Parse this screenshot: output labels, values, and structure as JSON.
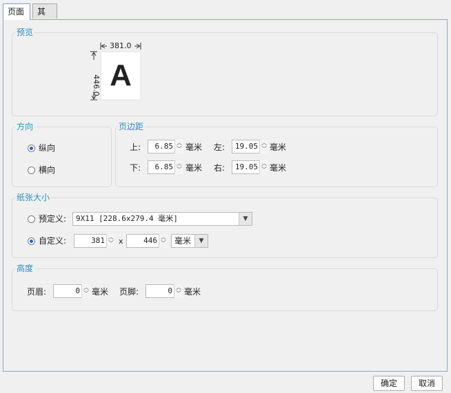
{
  "tabs": [
    {
      "label": "页面",
      "active": true
    },
    {
      "label": "其他",
      "active": false
    }
  ],
  "preview": {
    "title": "预览",
    "width_label": "381.0",
    "height_label": "446.0",
    "letter": "A"
  },
  "orientation": {
    "title": "方向",
    "portrait_label": "纵向",
    "landscape_label": "横向",
    "selected": "portrait"
  },
  "margins": {
    "title": "页边距",
    "top_label": "上:",
    "top_value": "6.85",
    "left_label": "左:",
    "left_value": "19.05",
    "bottom_label": "下:",
    "bottom_value": "6.85",
    "right_label": "右:",
    "right_value": "19.05",
    "unit": "毫米"
  },
  "paper": {
    "title": "纸张大小",
    "predefined_label": "预定义:",
    "predefined_value": "9X11 [228.6x279.4 毫米]",
    "custom_label": "自定义:",
    "custom_width": "381",
    "times": "x",
    "custom_height": "446",
    "unit_value": "毫米",
    "selected": "custom"
  },
  "height": {
    "title": "高度",
    "header_label": "页眉:",
    "header_value": "0",
    "footer_label": "页脚:",
    "footer_value": "0",
    "unit": "毫米"
  },
  "footer_buttons": {
    "ok": "确定",
    "cancel": "取消"
  },
  "colors": {
    "group_title": "#2b8fc0",
    "radio_dot": "#1e64c8",
    "panel_border": "#8aa7c8"
  }
}
